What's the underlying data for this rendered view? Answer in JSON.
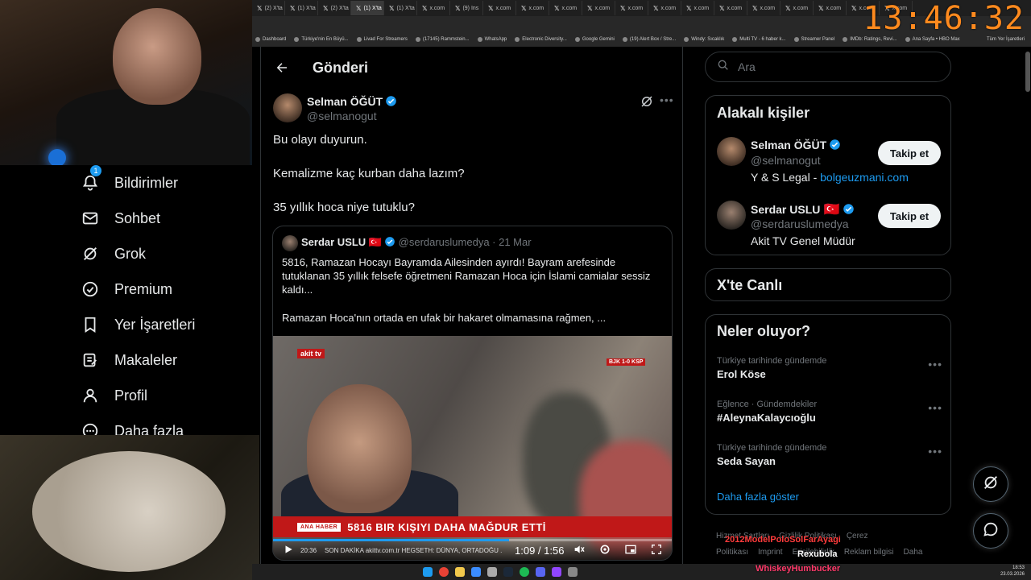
{
  "overlay": {
    "clock": "13:46:32"
  },
  "browser": {
    "tabs": [
      {
        "label": "(2) X'ta"
      },
      {
        "label": "(1) X'ta"
      },
      {
        "label": "(2) X'ta"
      },
      {
        "label": "(1) X'ta",
        "active": true
      },
      {
        "label": "(1) X'ta"
      },
      {
        "label": "x.com"
      },
      {
        "label": "(9) Ins"
      },
      {
        "label": "x.com"
      },
      {
        "label": "x.com"
      },
      {
        "label": "x.com"
      },
      {
        "label": "x.com"
      },
      {
        "label": "x.com"
      },
      {
        "label": "x.com"
      },
      {
        "label": "x.com"
      },
      {
        "label": "x.com"
      },
      {
        "label": "x.com"
      },
      {
        "label": "x.com"
      },
      {
        "label": "x.com"
      },
      {
        "label": "x.com"
      },
      {
        "label": "x.com"
      }
    ],
    "bookmarks": [
      "Dashboard",
      "Türkiye'nin En Büyü...",
      "Livad For Streamers",
      "(17145) Rammstein...",
      "WhatsApp",
      "Electronic Diversity...",
      "Google Gemini",
      "(19) Alert Box / Stre...",
      "Windy: Sıcaklık",
      "Multi TV - 6 haber k...",
      "Streamer Panel",
      "IMDb: Ratings, Revi...",
      "Ana Sayfa • HBO Max"
    ],
    "bookmarks_all": "Tüm Yer İşaretleri"
  },
  "nav": {
    "notification_count": "1",
    "items": [
      {
        "label": "Bildirimler",
        "icon": "bell-icon"
      },
      {
        "label": "Sohbet",
        "icon": "mail-icon"
      },
      {
        "label": "Grok",
        "icon": "grok-icon"
      },
      {
        "label": "Premium",
        "icon": "verified-badge-icon"
      },
      {
        "label": "Yer İşaretleri",
        "icon": "bookmark-icon"
      },
      {
        "label": "Makaleler",
        "icon": "article-icon"
      },
      {
        "label": "Profil",
        "icon": "person-icon"
      },
      {
        "label": "Daha fazla",
        "icon": "more-circle-icon"
      }
    ]
  },
  "post": {
    "header_title": "Gönderi",
    "author_name": "Selman ÖĞÜT",
    "author_handle": "@selmanogut",
    "lines": [
      "Bu olayı duyurun.",
      "Kemalizme kaç kurban daha lazım?",
      "35 yıllık hoca niye tutuklu?"
    ],
    "quote": {
      "author_name": "Serdar USLU",
      "flag": "🇹🇷",
      "handle_date": "@serdaruslumedya · 21 Mar",
      "text1": "5816, Ramazan Hocayı Bayramda Ailesinden ayırdı! Bayram arefesinde tutuklanan 35 yıllık felsefe öğretmeni Ramazan Hoca için İslami camialar sessiz kaldı...",
      "text2": "Ramazan Hoca'nın ortada en ufak bir hakaret olmamasına rağmen, ...",
      "video": {
        "channel_logo": "akit tv",
        "score": "BJK 1-0 KSP",
        "ticker_tag": "ANA HABER",
        "ticker": "5816 BIR KIŞIYI DAHA MAĞDUR ETTİ",
        "sub_ticker": "SON DAKİKA  akittv.com.tr  HEGSETH: DÜNYA, ORTADOĞU ...",
        "sub_time": "20:36",
        "time": "1:09 / 1:56",
        "progress": 0.59
      }
    }
  },
  "right": {
    "search_placeholder": "Ara",
    "related_title": "Alakalı kişiler",
    "people": [
      {
        "name": "Selman ÖĞÜT",
        "handle": "@selmanogut",
        "bio": "Y & S Legal - ",
        "bio_link": "bolgeuzmani.com",
        "button": "Takip et"
      },
      {
        "name": "Serdar USLU",
        "flag": "🇹🇷",
        "handle": "@serdaruslumedya",
        "bio": "Akit TV Genel Müdür",
        "button": "Takip et"
      }
    ],
    "live_title": "X'te Canlı",
    "trends_title": "Neler oluyor?",
    "trends": [
      {
        "meta": "Türkiye tarihinde gündemde",
        "title": "Erol Köse"
      },
      {
        "meta": "Eğlence · Gündemdekiler",
        "title": "#AleynaKalaycıoğlu"
      },
      {
        "meta": "Türkiye tarihinde gündemde",
        "title": "Seda Sayan"
      }
    ],
    "show_more": "Daha fazla göster",
    "footer": [
      "Hizmet Şartları",
      "Gizlilik Politikası",
      "Çerez Politikası",
      "Imprint",
      "Erişilebilirlik",
      "Reklam bilgisi",
      "Daha fazla ..."
    ]
  },
  "stream_chat": [
    {
      "user": "2012ModelPoloSolFarAyagi",
      "color": "#ff3b3b"
    },
    {
      "user": "Rexubola",
      "color": "#ffffff"
    },
    {
      "user": "WhiskeyHumbucker",
      "color": "#ff3b6b"
    }
  ],
  "taskbar": {
    "time": "18:53",
    "date": "23.03.2026"
  },
  "colors": {
    "accent": "#1d9bf0",
    "orange_clock": "#ff8a1e",
    "news_red": "#c01818"
  }
}
